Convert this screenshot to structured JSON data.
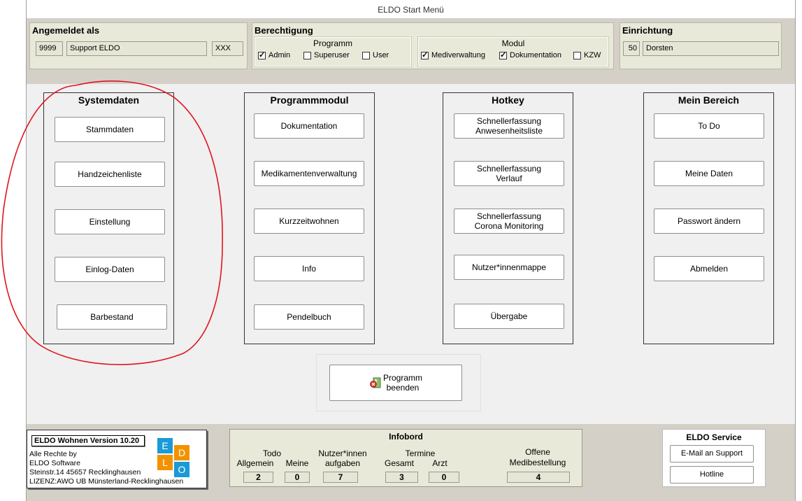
{
  "window": {
    "title": "ELDO Start Menü"
  },
  "login": {
    "title": "Angemeldet als",
    "user_id": "9999",
    "user_name": "Support ELDO",
    "user_code": "XXX"
  },
  "permission": {
    "title": "Berechtigung",
    "program_group": {
      "title": "Programm",
      "options": [
        {
          "label": "Admin",
          "checked": true
        },
        {
          "label": "Superuser",
          "checked": false
        },
        {
          "label": "User",
          "checked": false
        }
      ]
    },
    "module_group": {
      "title": "Modul",
      "options": [
        {
          "label": "Mediverwaltung",
          "checked": true
        },
        {
          "label": "Dokumentation",
          "checked": true
        },
        {
          "label": "KZW",
          "checked": false
        }
      ]
    }
  },
  "facility": {
    "title": "Einrichtung",
    "id": "50",
    "name": "Dorsten"
  },
  "columns": {
    "systemdaten": {
      "title": "Systemdaten",
      "buttons": [
        "Stammdaten",
        "Handzeichenliste",
        "Einstellung",
        "Einlog-Daten",
        "Barbestand"
      ]
    },
    "programmmodul": {
      "title": "Programmmodul",
      "buttons": [
        "Dokumentation",
        "Medikamentenverwaltung",
        "Kurzzeitwohnen",
        "Info",
        "Pendelbuch"
      ]
    },
    "hotkey": {
      "title": "Hotkey",
      "buttons": [
        {
          "line1": "Schnellerfassung",
          "line2": "Anwesenheitsliste"
        },
        {
          "line1": "Schnellerfassung",
          "line2": "Verlauf"
        },
        {
          "line1": "Schnellerfassung",
          "line2": "Corona Monitoring"
        },
        {
          "line1": "Nutzer*innenmappe",
          "line2": ""
        },
        {
          "line1": "Übergabe",
          "line2": ""
        }
      ]
    },
    "mein_bereich": {
      "title": "Mein Bereich",
      "buttons": [
        "To Do",
        "Meine Daten",
        "Passwort ändern",
        "Abmelden"
      ]
    }
  },
  "exit": {
    "line1": "Programm",
    "line2": "beenden",
    "icon": "exit-program-icon"
  },
  "about": {
    "title": "ELDO Wohnen Version 10.20",
    "lines": [
      "Alle Rechte by",
      "ELDO Software",
      "Steinstr.14 45657 Recklinghausen",
      "LIZENZ:AWO UB Münsterland-Recklinghausen"
    ],
    "logo_letters": [
      "E",
      "L",
      "D",
      "O"
    ],
    "logo_colors": [
      "#1a9ad6",
      "#f39200",
      "#f39200",
      "#1a9ad6"
    ]
  },
  "infobord": {
    "title": "Infobord",
    "todo": {
      "label": "Todo",
      "allgemein_label": "Allgemein",
      "allgemein": "2",
      "meine_label": "Meine",
      "meine": "0"
    },
    "nutzer": {
      "label_line1": "Nutzer*innen",
      "label_line2": "aufgaben",
      "value": "7"
    },
    "termine": {
      "label": "Termine",
      "gesamt_label": "Gesamt",
      "gesamt": "3",
      "arzt_label": "Arzt",
      "arzt": "0"
    },
    "medi": {
      "label_line1": "Offene",
      "label_line2": "Medibestellung",
      "value": "4"
    }
  },
  "service": {
    "title": "ELDO Service",
    "email_label": "E-Mail an Support",
    "hotline_label": "Hotline"
  },
  "annotation_color": "#e0141e"
}
